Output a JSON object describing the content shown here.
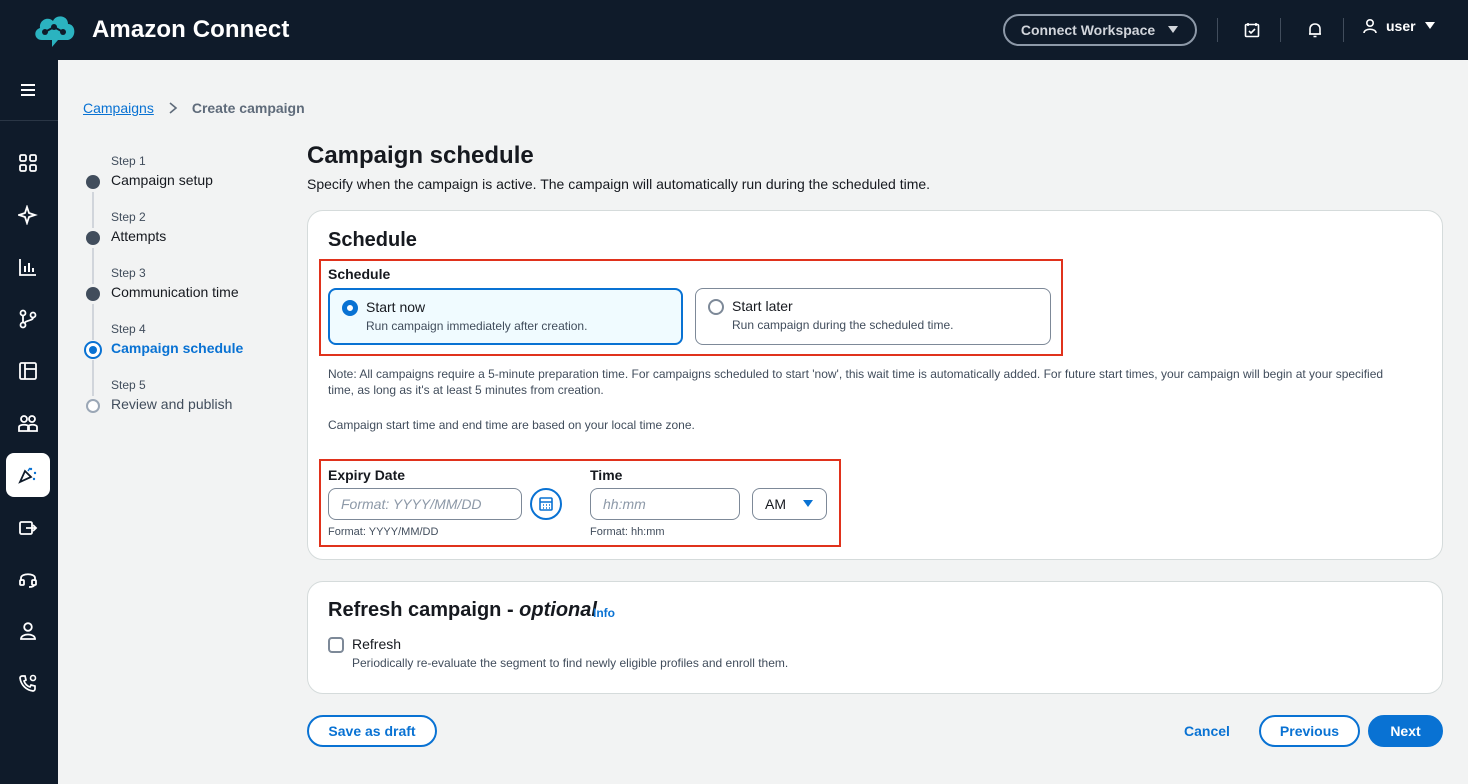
{
  "app": {
    "title": "Amazon Connect",
    "workspace_label": "Connect Workspace",
    "user_label": "user"
  },
  "breadcrumb": {
    "root": "Campaigns",
    "current": "Create campaign"
  },
  "steps": [
    {
      "num": "Step 1",
      "label": "Campaign setup"
    },
    {
      "num": "Step 2",
      "label": "Attempts"
    },
    {
      "num": "Step 3",
      "label": "Communication time"
    },
    {
      "num": "Step 4",
      "label": "Campaign schedule"
    },
    {
      "num": "Step 5",
      "label": "Review and publish"
    }
  ],
  "page": {
    "title": "Campaign schedule",
    "description": "Specify when the campaign is active. The campaign will automatically run during the scheduled time."
  },
  "schedule": {
    "card_title": "Schedule",
    "field_label": "Schedule",
    "options": [
      {
        "title": "Start now",
        "desc": "Run campaign immediately after creation.",
        "selected": true
      },
      {
        "title": "Start later",
        "desc": "Run campaign during the scheduled time.",
        "selected": false
      }
    ],
    "note": "Note: All campaigns require a 5-minute preparation time. For campaigns scheduled to start 'now', this wait time is automatically added. For future start times, your campaign will begin at your specified time, as long as it's at least 5 minutes from creation.",
    "timezone_note": "Campaign start time and end time are based on your local time zone.",
    "expiry_label": "Expiry Date",
    "expiry_placeholder": "Format: YYYY/MM/DD",
    "expiry_hint": "Format: YYYY/MM/DD",
    "time_label": "Time",
    "time_placeholder": "hh:mm",
    "time_hint": "Format: hh:mm",
    "ampm_value": "AM"
  },
  "refresh": {
    "title": "Refresh campaign - ",
    "optional": "optional",
    "info": "Info",
    "checkbox_label": "Refresh",
    "checkbox_desc": "Periodically re-evaluate the segment to find newly eligible profiles and enroll them."
  },
  "actions": {
    "save_draft": "Save as draft",
    "cancel": "Cancel",
    "previous": "Previous",
    "next": "Next"
  },
  "colors": {
    "accent": "#0972d3",
    "highlight": "#e0321c",
    "topbar": "#0f1b2a"
  }
}
